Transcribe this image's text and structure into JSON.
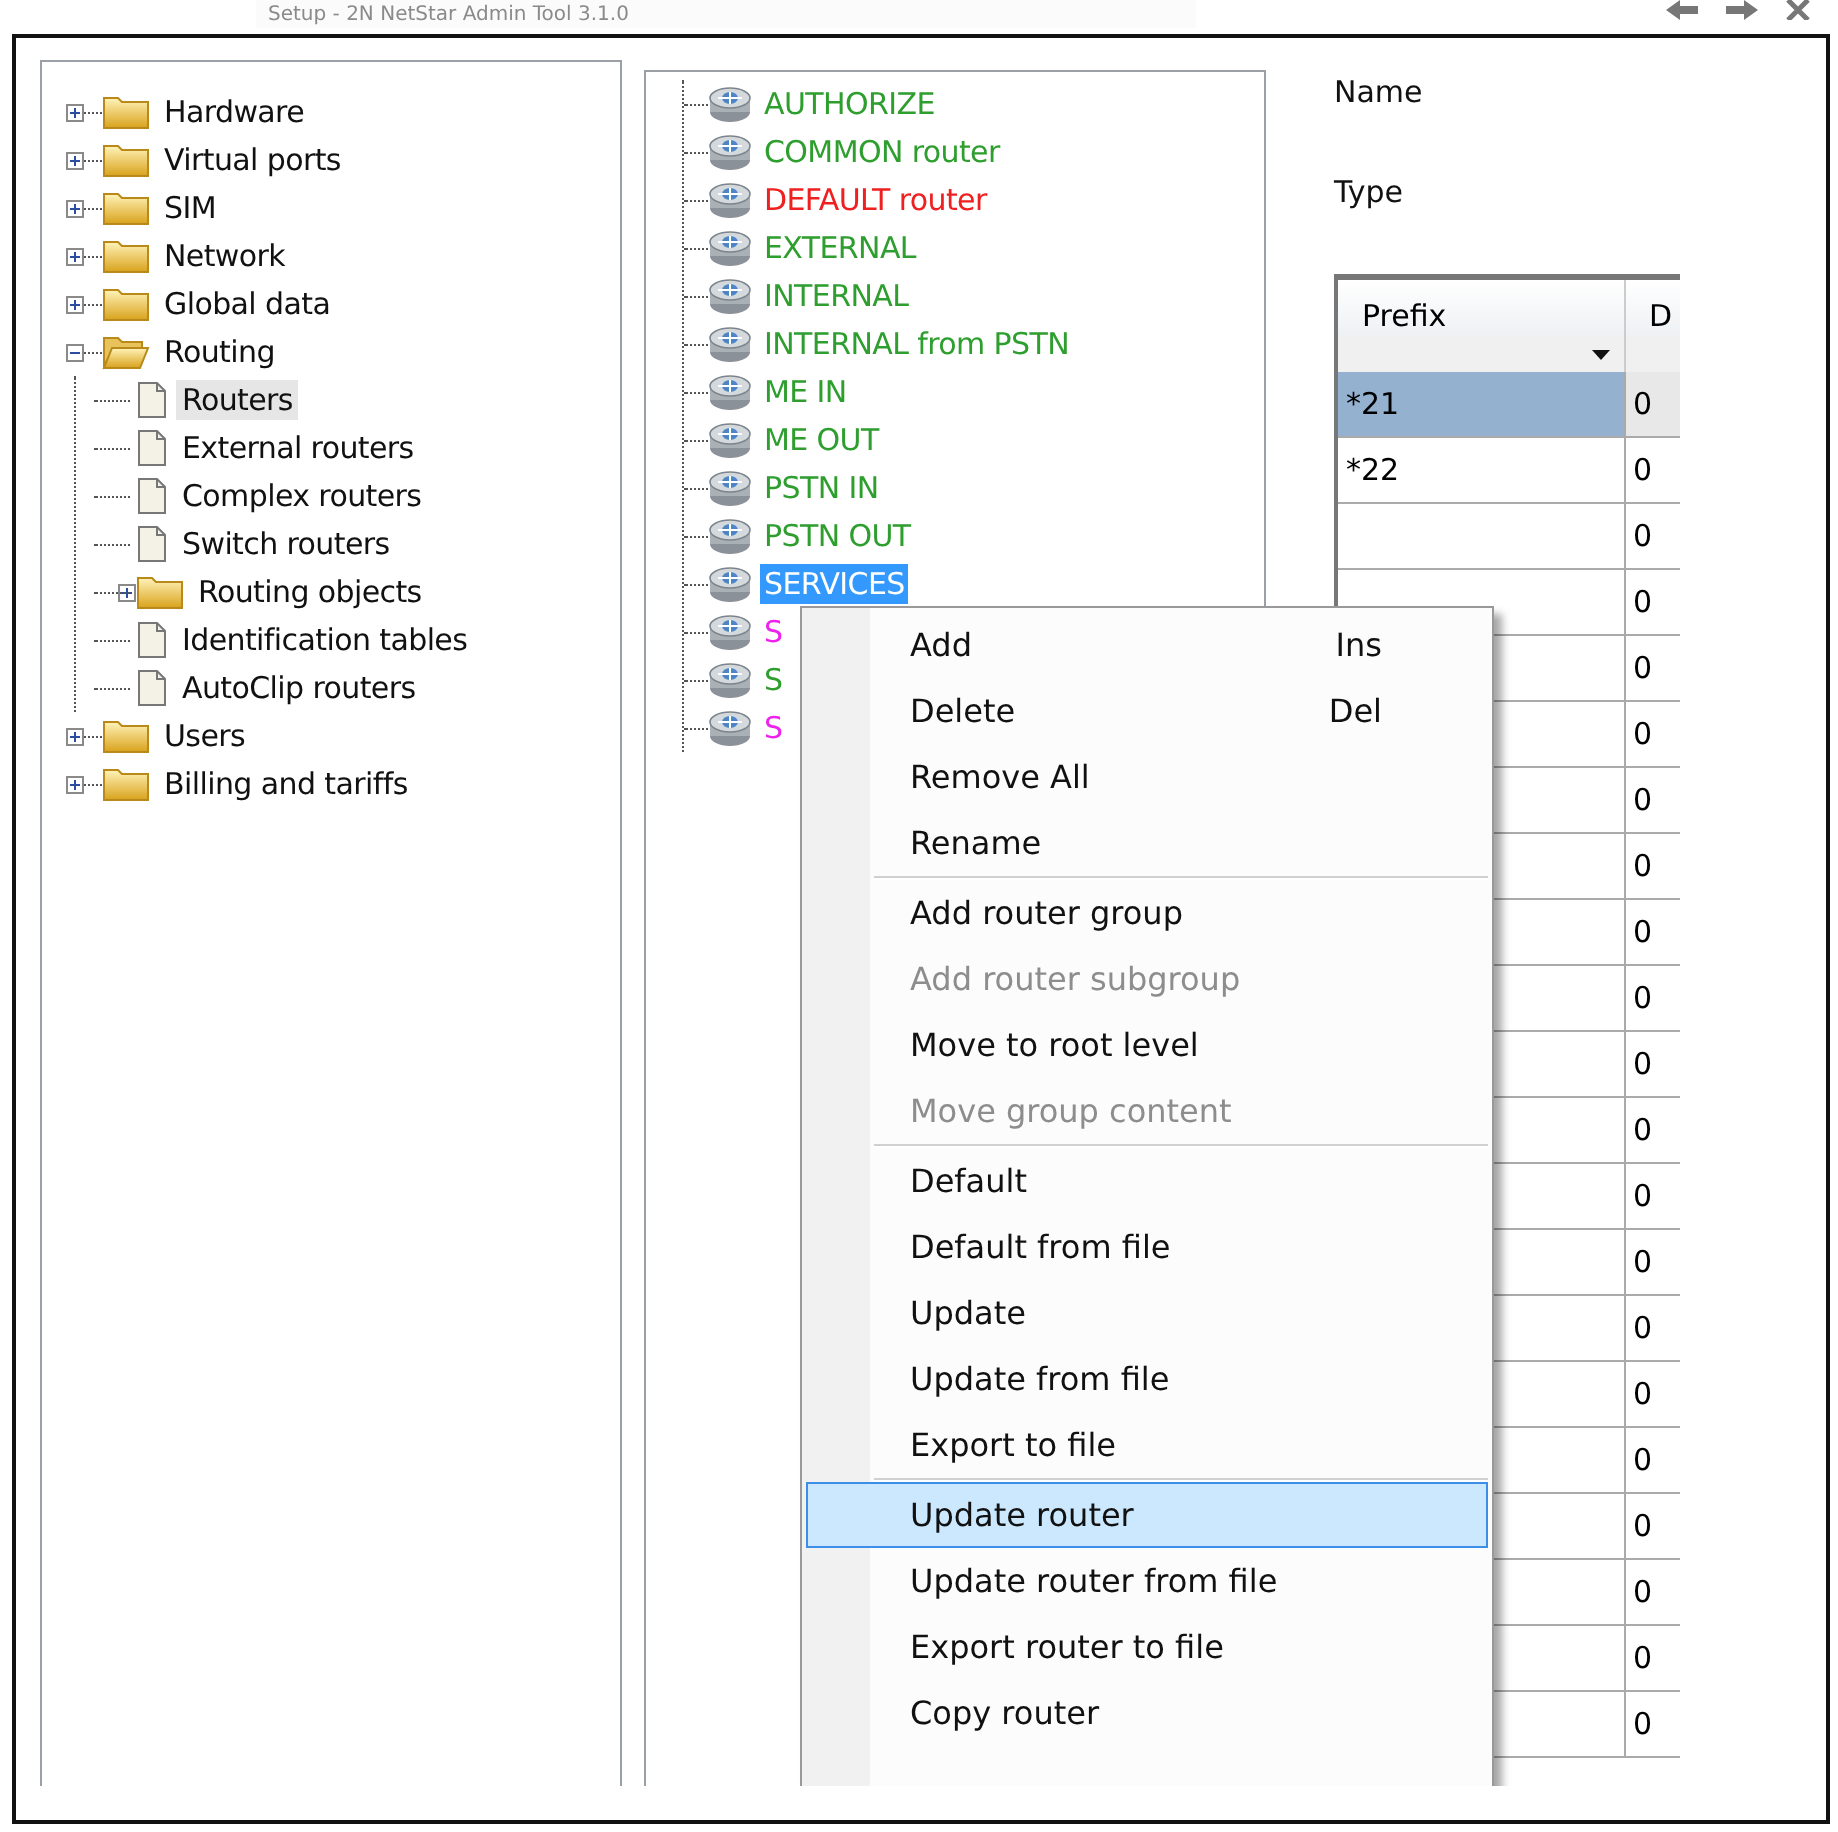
{
  "window": {
    "title": "Setup - 2N NetStar Admin Tool 3.1.0"
  },
  "nav_tree": [
    {
      "label": "Hardware",
      "expanded": false,
      "selected": false
    },
    {
      "label": "Virtual ports",
      "expanded": false,
      "selected": false
    },
    {
      "label": "SIM",
      "expanded": false,
      "selected": false
    },
    {
      "label": "Network",
      "expanded": false,
      "selected": false
    },
    {
      "label": "Global data",
      "expanded": false,
      "selected": false
    },
    {
      "label": "Routing",
      "expanded": true,
      "selected": false,
      "children": [
        {
          "label": "Routers",
          "kind": "document",
          "selected": true
        },
        {
          "label": "External routers",
          "kind": "document",
          "selected": false
        },
        {
          "label": "Complex routers",
          "kind": "document",
          "selected": false
        },
        {
          "label": "Switch routers",
          "kind": "document",
          "selected": false
        },
        {
          "label": "Routing objects",
          "kind": "folder",
          "expanded": false,
          "selected": false
        },
        {
          "label": "Identification tables",
          "kind": "document",
          "selected": false
        },
        {
          "label": "AutoClip routers",
          "kind": "document",
          "selected": false
        }
      ]
    },
    {
      "label": "Users",
      "expanded": false,
      "selected": false
    },
    {
      "label": "Billing and tariffs",
      "expanded": false,
      "selected": false
    }
  ],
  "routers": [
    {
      "label": "AUTHORIZE",
      "color": "#2e9e2e",
      "selected": false
    },
    {
      "label": "COMMON router",
      "color": "#2e9e2e",
      "selected": false
    },
    {
      "label": "DEFAULT router",
      "color": "#ee2020",
      "selected": false
    },
    {
      "label": "EXTERNAL",
      "color": "#2e9e2e",
      "selected": false
    },
    {
      "label": "INTERNAL",
      "color": "#2e9e2e",
      "selected": false
    },
    {
      "label": "INTERNAL from PSTN",
      "color": "#2e9e2e",
      "selected": false
    },
    {
      "label": "ME IN",
      "color": "#2e9e2e",
      "selected": false
    },
    {
      "label": "ME OUT",
      "color": "#2e9e2e",
      "selected": false
    },
    {
      "label": "PSTN IN",
      "color": "#2e9e2e",
      "selected": false
    },
    {
      "label": "PSTN OUT",
      "color": "#2e9e2e",
      "selected": false
    },
    {
      "label": "SERVICES",
      "selected": true
    },
    {
      "label": "S",
      "color": "#ee22ee",
      "selected": false
    },
    {
      "label": "S",
      "color": "#2e9e2e",
      "selected": false
    },
    {
      "label": "S",
      "color": "#ee22ee",
      "selected": false
    }
  ],
  "details": {
    "name_label": "Name",
    "type_label": "Type"
  },
  "table": {
    "columns": [
      "Prefix",
      "D"
    ],
    "rows": [
      {
        "prefix": "*21",
        "column_2": "0",
        "selected": true
      },
      {
        "prefix": "*22",
        "column_2": "0",
        "selected": false
      },
      {
        "column_2": "0",
        "selected": false
      },
      {
        "column_2": "0",
        "selected": false
      },
      {
        "column_2": "0",
        "selected": false
      },
      {
        "column_2": "0",
        "selected": false
      },
      {
        "column_2": "0",
        "selected": false
      },
      {
        "column_2": "0",
        "selected": false
      },
      {
        "column_2": "0",
        "selected": false
      },
      {
        "column_2": "0",
        "selected": false
      },
      {
        "column_2": "0",
        "selected": false
      },
      {
        "column_2": "0",
        "selected": false
      },
      {
        "column_2": "0",
        "selected": false
      },
      {
        "column_2": "0",
        "selected": false
      },
      {
        "column_2": "0",
        "selected": false
      },
      {
        "column_2": "0",
        "selected": false
      },
      {
        "column_2": "0",
        "selected": false
      },
      {
        "column_2": "0",
        "selected": false
      },
      {
        "column_2": "0",
        "selected": false
      },
      {
        "column_2": "0",
        "selected": false
      },
      {
        "column_2": "0",
        "selected": false
      }
    ]
  },
  "context_menu": [
    {
      "kind": "item",
      "label": "Add",
      "shortcut": "Ins",
      "disabled": false,
      "selected": false
    },
    {
      "kind": "item",
      "label": "Delete",
      "shortcut": "Del",
      "disabled": false,
      "selected": false
    },
    {
      "kind": "item",
      "label": "Remove All",
      "disabled": false,
      "selected": false
    },
    {
      "kind": "item",
      "label": "Rename",
      "disabled": false,
      "selected": false
    },
    {
      "kind": "separator"
    },
    {
      "kind": "item",
      "label": "Add router group",
      "disabled": false,
      "selected": false
    },
    {
      "kind": "item",
      "label": "Add router subgroup",
      "disabled": true,
      "selected": false
    },
    {
      "kind": "item",
      "label": "Move to root level",
      "disabled": false,
      "selected": false
    },
    {
      "kind": "item",
      "label": "Move group content",
      "disabled": true,
      "selected": false
    },
    {
      "kind": "separator"
    },
    {
      "kind": "item",
      "label": "Default",
      "disabled": false,
      "selected": false
    },
    {
      "kind": "item",
      "label": "Default from file",
      "disabled": false,
      "selected": false
    },
    {
      "kind": "item",
      "label": "Update",
      "disabled": false,
      "selected": false
    },
    {
      "kind": "item",
      "label": "Update from file",
      "disabled": false,
      "selected": false
    },
    {
      "kind": "item",
      "label": "Export to file",
      "disabled": false,
      "selected": false
    },
    {
      "kind": "separator"
    },
    {
      "kind": "item",
      "label": "Update router",
      "disabled": false,
      "selected": true
    },
    {
      "kind": "item",
      "label": "Update router from file",
      "disabled": false,
      "selected": false
    },
    {
      "kind": "item",
      "label": "Export router to file",
      "disabled": false,
      "selected": false
    },
    {
      "kind": "item",
      "label": "Copy router",
      "disabled": false,
      "selected": false
    }
  ]
}
